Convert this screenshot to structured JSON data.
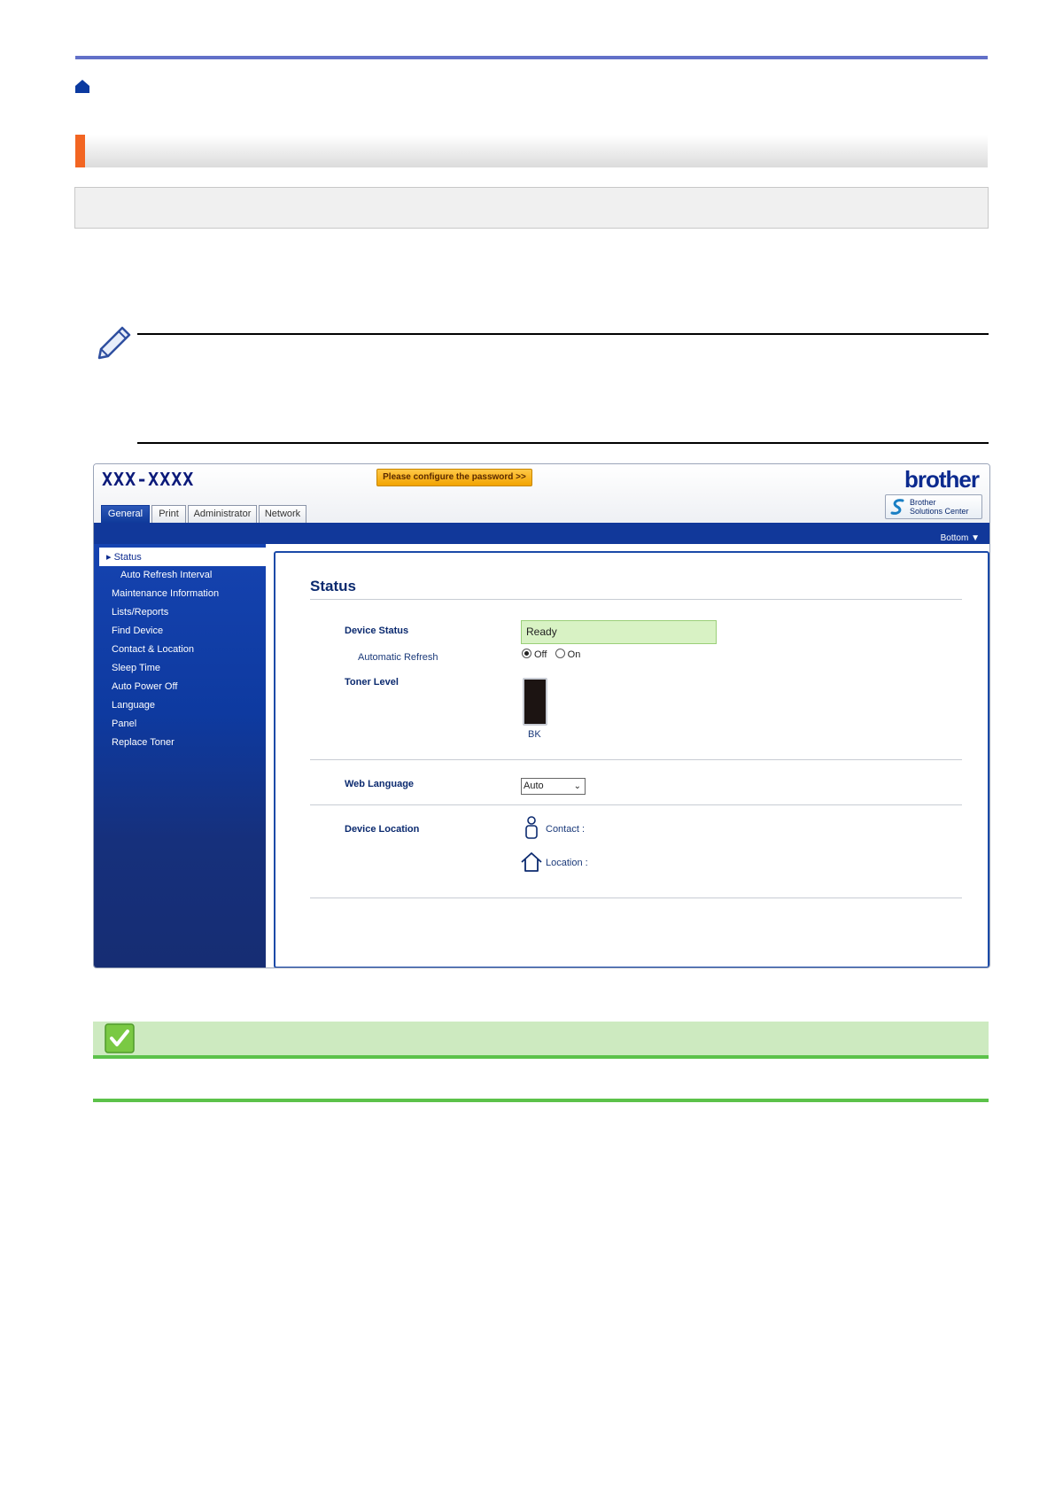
{
  "webui": {
    "model_name": "XXX-XXXX",
    "password_button": "Please configure the password >>",
    "brand_logo": "brother",
    "solutions_center": {
      "line1": "Brother",
      "line2": "Solutions Center"
    },
    "tabs": [
      {
        "label": "General",
        "active": true
      },
      {
        "label": "Print",
        "active": false
      },
      {
        "label": "Administrator",
        "active": false
      },
      {
        "label": "Network",
        "active": false
      }
    ],
    "bottom_link": "Bottom ▼",
    "nav": {
      "selected": "Status",
      "sub": "Auto Refresh Interval",
      "items": [
        "Maintenance Information",
        "Lists/Reports",
        "Find Device",
        "Contact & Location",
        "Sleep Time",
        "Auto Power Off",
        "Language",
        "Panel",
        "Replace Toner"
      ]
    },
    "panel": {
      "title": "Status",
      "device_status_label": "Device Status",
      "device_status_value": "Ready",
      "auto_refresh_label": "Automatic Refresh",
      "radio_off": "Off",
      "radio_on": "On",
      "auto_refresh_selected": "Off",
      "toner_label": "Toner Level",
      "toner_color": "BK",
      "web_language_label": "Web Language",
      "web_language_value": "Auto",
      "device_location_label": "Device Location",
      "contact_label": "Contact :",
      "location_label": "Location :"
    }
  },
  "colors": {
    "accent_orange": "#f26522",
    "rule_blue": "#6270c8",
    "nav_blue": "#11389a",
    "related_green": "#5cc24a"
  },
  "icons": [
    "home-icon",
    "pencil-icon",
    "check-icon",
    "contact-icon",
    "location-icon"
  ]
}
